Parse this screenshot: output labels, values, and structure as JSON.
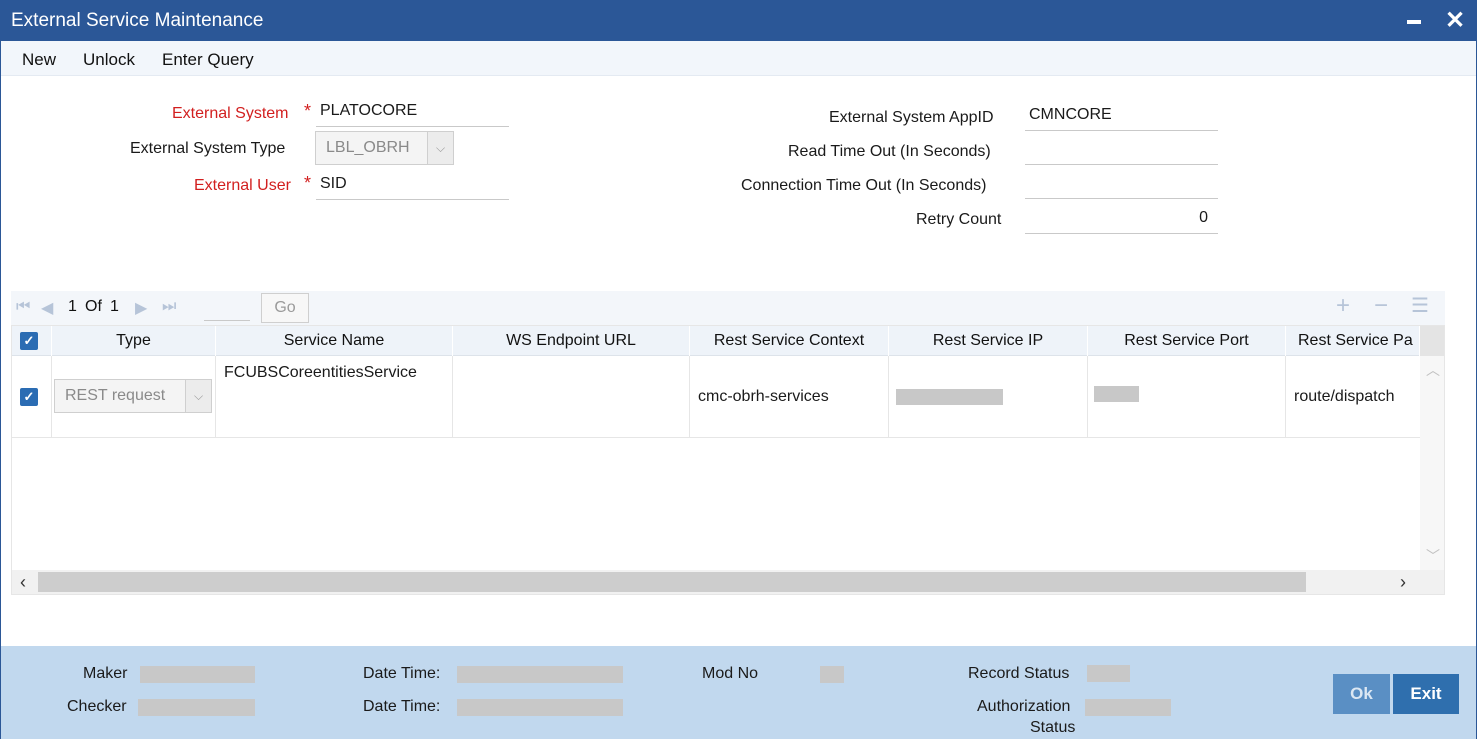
{
  "window": {
    "title": "External Service Maintenance"
  },
  "toolbar": {
    "new_label": "New",
    "unlock_label": "Unlock",
    "enter_query_label": "Enter Query"
  },
  "form": {
    "external_system": {
      "label": "External System",
      "value": "PLATOCORE",
      "required": true
    },
    "external_system_type": {
      "label": "External System Type",
      "value": "LBL_OBRH"
    },
    "external_user": {
      "label": "External User",
      "value": "SID",
      "required": true
    },
    "external_system_appid": {
      "label": "External System AppID",
      "value": "CMNCORE"
    },
    "read_time_out": {
      "label": "Read Time Out (In Seconds)",
      "value": ""
    },
    "connection_time_out": {
      "label": "Connection Time Out (In Seconds)",
      "value": ""
    },
    "retry_count": {
      "label": "Retry Count",
      "value": "0"
    },
    "required_marker": "*"
  },
  "pager": {
    "current": "1",
    "of_label": "Of",
    "total": "1",
    "go_label": "Go"
  },
  "grid": {
    "columns": [
      "Type",
      "Service Name",
      "WS Endpoint URL",
      "Rest Service Context",
      "Rest Service IP",
      "Rest Service Port",
      "Rest Service Pa"
    ],
    "rows": [
      {
        "checked": true,
        "type": "REST request",
        "service_name": "FCUBSCoreentitiesService",
        "ws_endpoint_url": "",
        "rest_service_context": "cmc-obrh-services",
        "rest_service_ip": "",
        "rest_service_port": "",
        "rest_service_path": "route/dispatch"
      }
    ]
  },
  "footer": {
    "maker_label": "Maker",
    "checker_label": "Checker",
    "date_time_label_1": "Date Time:",
    "date_time_label_2": "Date Time:",
    "mod_no_label": "Mod No",
    "record_status_label": "Record Status",
    "authorization_label": "Authorization",
    "status_label": "Status",
    "ok_label": "Ok",
    "exit_label": "Exit"
  },
  "colors": {
    "primary": "#2b5797",
    "required": "#d21f1f",
    "footer_bg": "#c1d8ee",
    "button_bg": "#2f6fae",
    "checkbox": "#2b6cb3"
  }
}
